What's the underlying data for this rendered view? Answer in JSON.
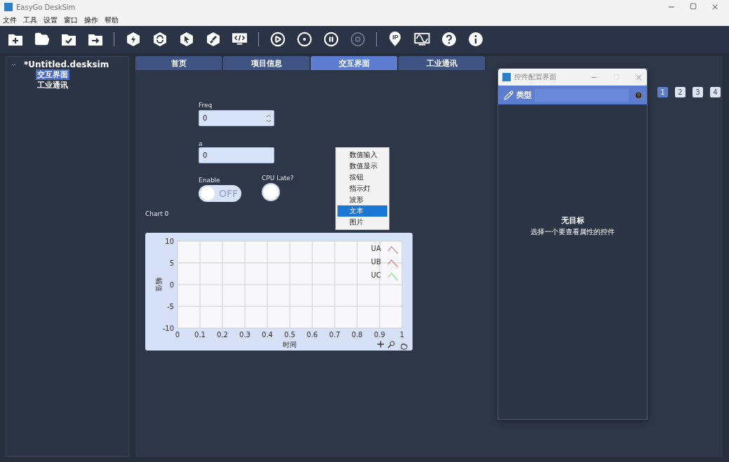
{
  "window": {
    "title": "EasyGo DeskSim"
  },
  "menu_bar": [
    "文件",
    "工具",
    "设置",
    "窗口",
    "操作",
    "帮助"
  ],
  "toolbar": [
    {
      "disabled": false
    },
    {
      "disabled": false
    },
    {
      "disabled": false
    },
    {
      "disabled": false
    },
    {
      "disabled": false
    },
    {
      "disabled": false
    },
    {
      "disabled": false
    },
    {
      "disabled": false
    },
    {
      "disabled": false
    },
    {
      "disabled": false
    },
    {
      "disabled": false
    },
    {
      "disabled": false
    },
    {
      "disabled": true
    },
    {
      "disabled": false,
      "label": "IP"
    },
    {
      "disabled": false
    },
    {
      "disabled": false
    },
    {
      "disabled": false
    }
  ],
  "tree": {
    "label": "*Untitled.desksim",
    "expanded": true,
    "children": [
      {
        "label": "交互界面",
        "selected": true
      },
      {
        "label": "工业通讯",
        "selected": false
      }
    ]
  },
  "tabs": [
    {
      "label": "首页",
      "selected": false
    },
    {
      "label": "项目信息",
      "selected": false
    },
    {
      "label": "交互界面",
      "selected": true
    },
    {
      "label": "工业通讯",
      "selected": false
    }
  ],
  "pages": [
    {
      "label": "1",
      "selected": true
    },
    {
      "label": "2",
      "selected": false
    },
    {
      "label": "3",
      "selected": false
    },
    {
      "label": "4",
      "selected": false
    }
  ],
  "widgets": {
    "freq": {
      "label": "Freq",
      "value": "0"
    },
    "a": {
      "label": "a",
      "value": "0"
    },
    "enable": {
      "label": "Enable",
      "on": false,
      "state_text": "OFF"
    },
    "cpu_late": {
      "label": "CPU Late?",
      "lit": false
    }
  },
  "context_menu": [
    {
      "label": "数值输入",
      "selected": false
    },
    {
      "label": "数值显示",
      "selected": false
    },
    {
      "label": "按钮",
      "selected": false
    },
    {
      "label": "指示灯",
      "selected": false
    },
    {
      "label": "波形",
      "selected": false
    },
    {
      "label": "文本",
      "selected": true
    },
    {
      "label": "图片",
      "selected": false
    }
  ],
  "chart": {
    "title": "Chart 0",
    "chart_data": {
      "type": "line",
      "xlabel": "时间",
      "ylabel": "幅值",
      "categories": [
        "0",
        "0.1",
        "0.2",
        "0.3",
        "0.4",
        "0.5",
        "0.6",
        "0.7",
        "0.8",
        "0.9",
        "1"
      ],
      "ylim": [
        -10,
        10
      ],
      "grid": true,
      "yticks": [
        10,
        5,
        0,
        -5,
        -10
      ],
      "series": [
        {
          "name": "UA",
          "color": "#c49aa6",
          "values": [
            null,
            null,
            null,
            null,
            null,
            null,
            null,
            null,
            null,
            null,
            null
          ]
        },
        {
          "name": "UB",
          "color": "#e08a8a",
          "values": [
            null,
            null,
            null,
            null,
            null,
            null,
            null,
            null,
            null,
            null,
            null
          ]
        },
        {
          "name": "UC",
          "color": "#9fe09a",
          "values": [
            null,
            null,
            null,
            null,
            null,
            null,
            null,
            null,
            null,
            null,
            null
          ]
        }
      ]
    }
  },
  "config_window": {
    "title": "控件配置界面",
    "header_label": "类型",
    "empty_title": "无目标",
    "empty_text": "选择一个要查看属性的控件"
  }
}
